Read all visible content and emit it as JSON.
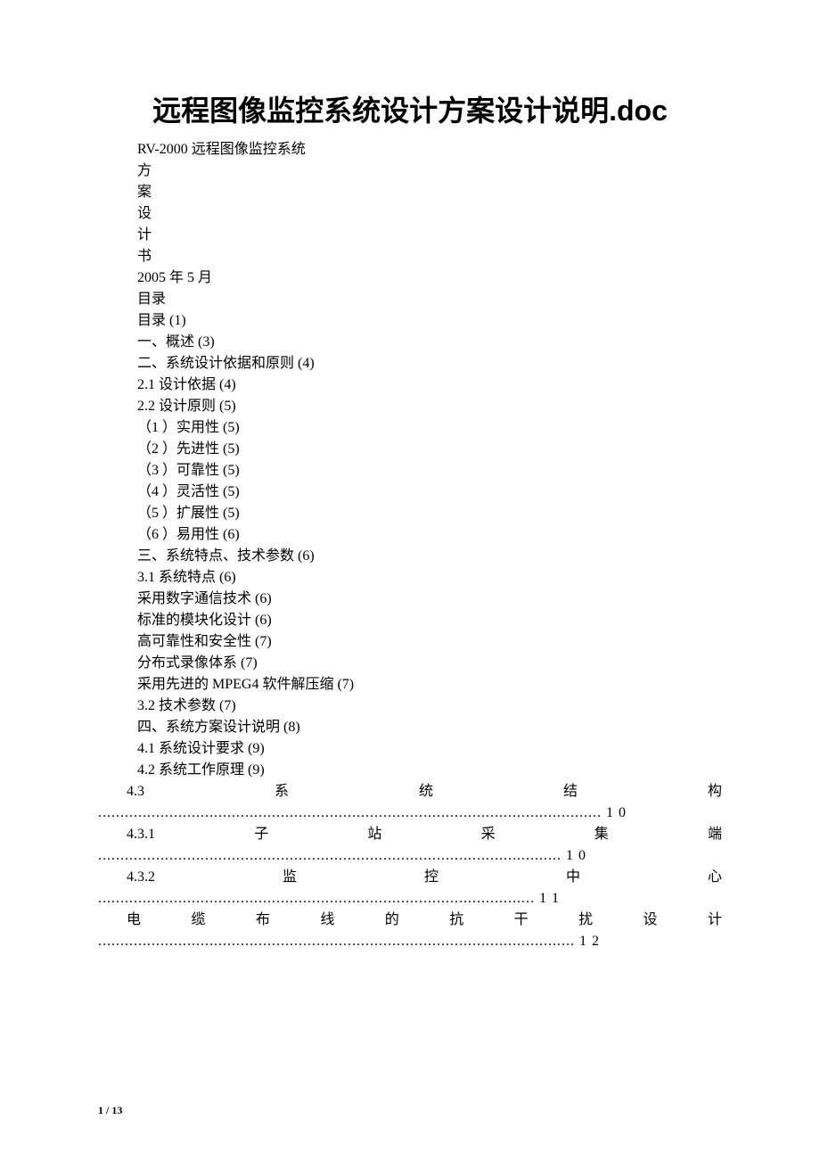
{
  "title": "远程图像监控系统设计方案设计说明.doc",
  "subtitle": "RV-2000 远程图像监控系统",
  "cover_vertical": [
    "方",
    "案",
    "设",
    "计",
    "书"
  ],
  "date": "2005 年 5 月",
  "toc_header": "目录",
  "toc": [
    "目录 (1)",
    "一、概述 (3)",
    "二、系统设计依据和原则 (4)",
    "2.1 设计依据 (4)",
    "2.2 设计原则 (5)",
    "（1 ）实用性 (5)",
    "（2 ）先进性 (5)",
    "（3 ）可靠性 (5)",
    "（4 ）灵活性 (5)",
    "（5 ）扩展性 (5)",
    "（6 ）易用性 (6)",
    "三、系统特点、技术参数 (6)",
    "3.1 系统特点 (6)",
    "采用数字通信技术 (6)",
    "标准的模块化设计 (6)",
    "高可靠性和安全性 (7)",
    "分布式录像体系 (7)",
    "采用先进的 MPEG4 软件解压缩 (7)",
    "3.2 技术参数 (7)",
    "四、系统方案设计说明 (8)",
    "4.1 系统设计要求 (9)",
    "4.2 系统工作原理 (9)"
  ],
  "justify_items": [
    {
      "line": "4.3　系　统　结　构",
      "dots": "................................................................................................................. 1 0"
    },
    {
      "line": "4.3.1　子　站　采　集　端",
      "dots": "........................................................................................................ 1 0"
    },
    {
      "line": "4.3.2　监　控　中　心",
      "dots": ".................................................................................................. 1 1"
    },
    {
      "line": "电　缆　布　线　的　抗　干　扰　设　计",
      "dots": "........................................................................................................... 1 2"
    }
  ],
  "page_number": "1 / 13"
}
